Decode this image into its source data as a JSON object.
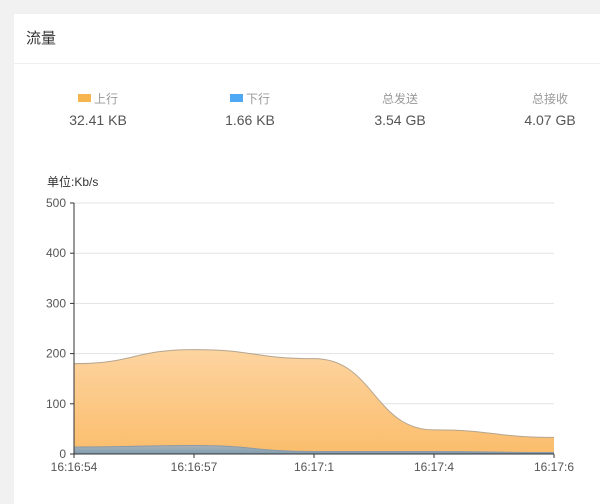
{
  "panel": {
    "title": "流量"
  },
  "stats": [
    {
      "label": "上行",
      "value": "32.41 KB",
      "color": "#f7b550"
    },
    {
      "label": "下行",
      "value": "1.66 KB",
      "color": "#4fa8f4"
    },
    {
      "label": "总发送",
      "value": "3.54 GB"
    },
    {
      "label": "总接收",
      "value": "4.07 GB"
    }
  ],
  "chart_data": {
    "type": "area",
    "ylabel": "单位:Kb/s",
    "ylim": [
      0,
      500
    ],
    "yticks": [
      "0",
      "100",
      "200",
      "300",
      "400",
      "500"
    ],
    "categories": [
      "16:16:54",
      "16:16:57",
      "16:17:1",
      "16:17:4",
      "16:17:6"
    ],
    "series": [
      {
        "name": "上行",
        "values": [
          180,
          208,
          190,
          48,
          33
        ],
        "color": "#fcc580"
      },
      {
        "name": "下行",
        "values": [
          14,
          17,
          5,
          5,
          3
        ],
        "color": "#8fa4b4"
      }
    ],
    "grid": true
  }
}
